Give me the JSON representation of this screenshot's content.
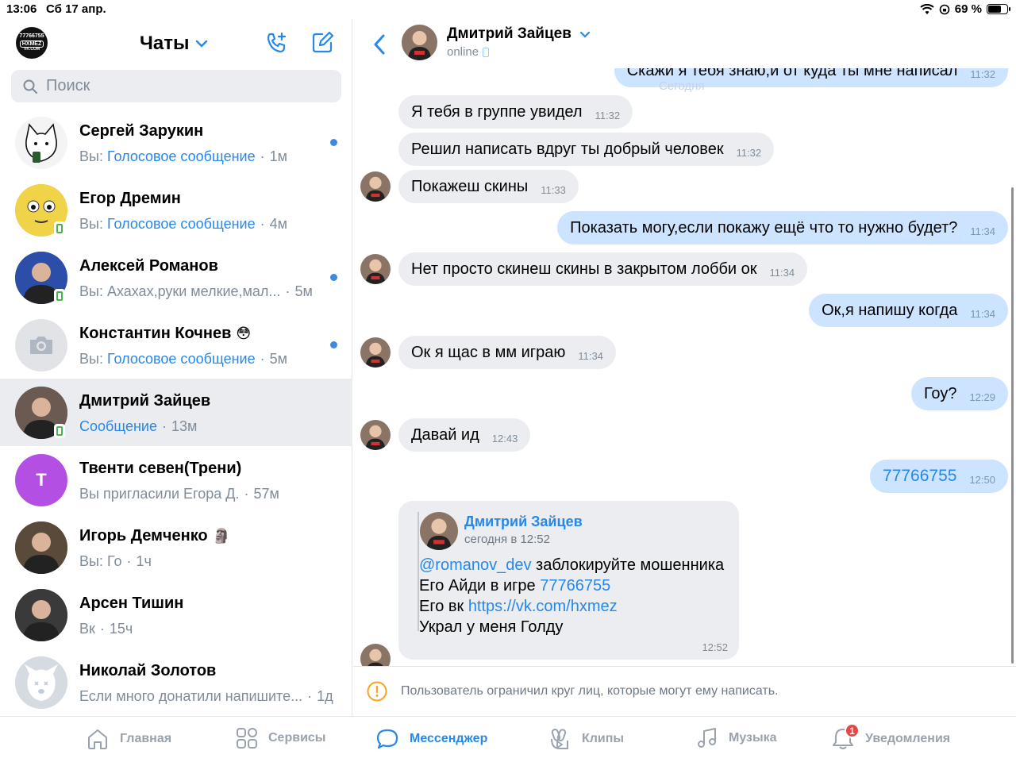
{
  "status_bar": {
    "time": "13:06",
    "date": "Сб 17 апр.",
    "battery": "69 %",
    "battery_level": 0.69
  },
  "left": {
    "title": "Чаты",
    "my_avatar_text": [
      "77766755",
      "HXMEZ",
      "VK.COM"
    ],
    "search_placeholder": "Поиск",
    "chats": [
      {
        "name": "Сергей Зарукин",
        "prefix": "Вы: ",
        "preview": "Голосовое сообщение",
        "preview_blue": true,
        "time": "1м",
        "unread": true,
        "online": false,
        "avatar_color": "#f4f4f4"
      },
      {
        "name": "Егор Дремин",
        "prefix": "Вы: ",
        "preview": "Голосовое сообщение",
        "preview_blue": true,
        "time": "4м",
        "unread": false,
        "online": true,
        "avatar_color": "#f1d34a"
      },
      {
        "name": "Алексей Романов",
        "prefix": "",
        "preview": "Вы: Ахахах,руки мелкие,мал...",
        "preview_blue": false,
        "time": "5м",
        "unread": true,
        "online": true,
        "avatar_color": "#2b4fa8"
      },
      {
        "name": "Константин Кочнев",
        "emoji": "😳",
        "prefix": "Вы: ",
        "preview": "Голосовое сообщение",
        "preview_blue": true,
        "time": "5м",
        "unread": true,
        "online": false,
        "avatar_color": "#e1e3e6"
      },
      {
        "name": "Дмитрий Зайцев",
        "prefix": "",
        "preview": "Сообщение",
        "preview_blue": true,
        "time": "13м",
        "unread": false,
        "online": true,
        "active": true,
        "avatar_color": "#6b5a52"
      },
      {
        "name": "Твенти севен(Трени)",
        "prefix": "",
        "preview": "Вы пригласили Егора Д.",
        "preview_blue": false,
        "time": "57м",
        "unread": false,
        "online": false,
        "avatar_letter": "Т",
        "avatar_color": "#b44fe3"
      },
      {
        "name": "Игорь Демченко",
        "emoji": "🗿",
        "prefix": "Вы: ",
        "preview": "Го",
        "preview_blue": false,
        "time": "1ч",
        "unread": false,
        "online": false,
        "avatar_color": "#5a4a3a"
      },
      {
        "name": "Арсен Тишин",
        "prefix": "",
        "preview": "Вк",
        "preview_blue": false,
        "time": "15ч",
        "unread": false,
        "online": false,
        "avatar_color": "#3a3a3a"
      },
      {
        "name": "Николай Золотов",
        "prefix": "",
        "preview": "Если много донатили напишите...",
        "preview_blue": false,
        "time": "1д",
        "unread": false,
        "online": false,
        "avatar_color": "#d6dbe2"
      }
    ]
  },
  "conversation": {
    "peer_name": "Дмитрий Зайцев",
    "peer_status": "online",
    "date_separator": "Сегодня",
    "messages": [
      {
        "dir": "out",
        "text": "Скажи я тебя знаю,и от куда ты мне написал",
        "time": "11:32"
      },
      {
        "dir": "in",
        "text": "Я тебя в группе увидел",
        "time": "11:32"
      },
      {
        "dir": "in",
        "text": "Решил написать вдруг ты добрый человек",
        "time": "11:32"
      },
      {
        "dir": "in",
        "text": "Покажеш скины",
        "time": "11:33"
      },
      {
        "dir": "out",
        "text": "Показать могу,если покажу ещё что то нужно будет?",
        "time": "11:34"
      },
      {
        "dir": "in",
        "text": "Нет просто скинеш скины в закрытом лобби ок",
        "time": "11:34"
      },
      {
        "dir": "out",
        "text": "Ок,я напишу когда",
        "time": "11:34"
      },
      {
        "dir": "in",
        "text": "Ок я щас в мм играю",
        "time": "11:34"
      },
      {
        "dir": "out",
        "text": "Гоу?",
        "time": "12:29"
      },
      {
        "dir": "in",
        "text": "Давай ид",
        "time": "12:43"
      },
      {
        "dir": "out",
        "text": "77766755",
        "time": "12:50",
        "link": true
      }
    ],
    "forwarded": {
      "author": "Дмитрий Зайцев",
      "date": "сегодня в 12:52",
      "mention": "@romanov_dev",
      "line1_rest": " заблокируйте мошенника",
      "line2_prefix": "Его Айди в игре ",
      "line2_link": "77766755",
      "line3_prefix": "Его вк ",
      "line3_link": "https://vk.com/hxmez",
      "line4": "Украл у меня Голду",
      "time": "12:52"
    },
    "restriction_notice": "Пользователь ограничил круг лиц, которые могут ему написать."
  },
  "tabbar": {
    "tabs": [
      {
        "label": "Главная",
        "icon": "home-icon"
      },
      {
        "label": "Сервисы",
        "icon": "services-icon"
      },
      {
        "label": "Мессенджер",
        "icon": "messenger-icon",
        "active": true
      },
      {
        "label": "Клипы",
        "icon": "clips-icon"
      },
      {
        "label": "Музыка",
        "icon": "music-icon"
      },
      {
        "label": "Уведомления",
        "icon": "bell-icon",
        "badge": "1"
      }
    ]
  },
  "colors": {
    "accent": "#2688eb",
    "bubble_out": "#cce4ff",
    "bubble_in": "#ebedf0",
    "unread_dot": "#3f8ae0",
    "badge": "#e64646"
  }
}
